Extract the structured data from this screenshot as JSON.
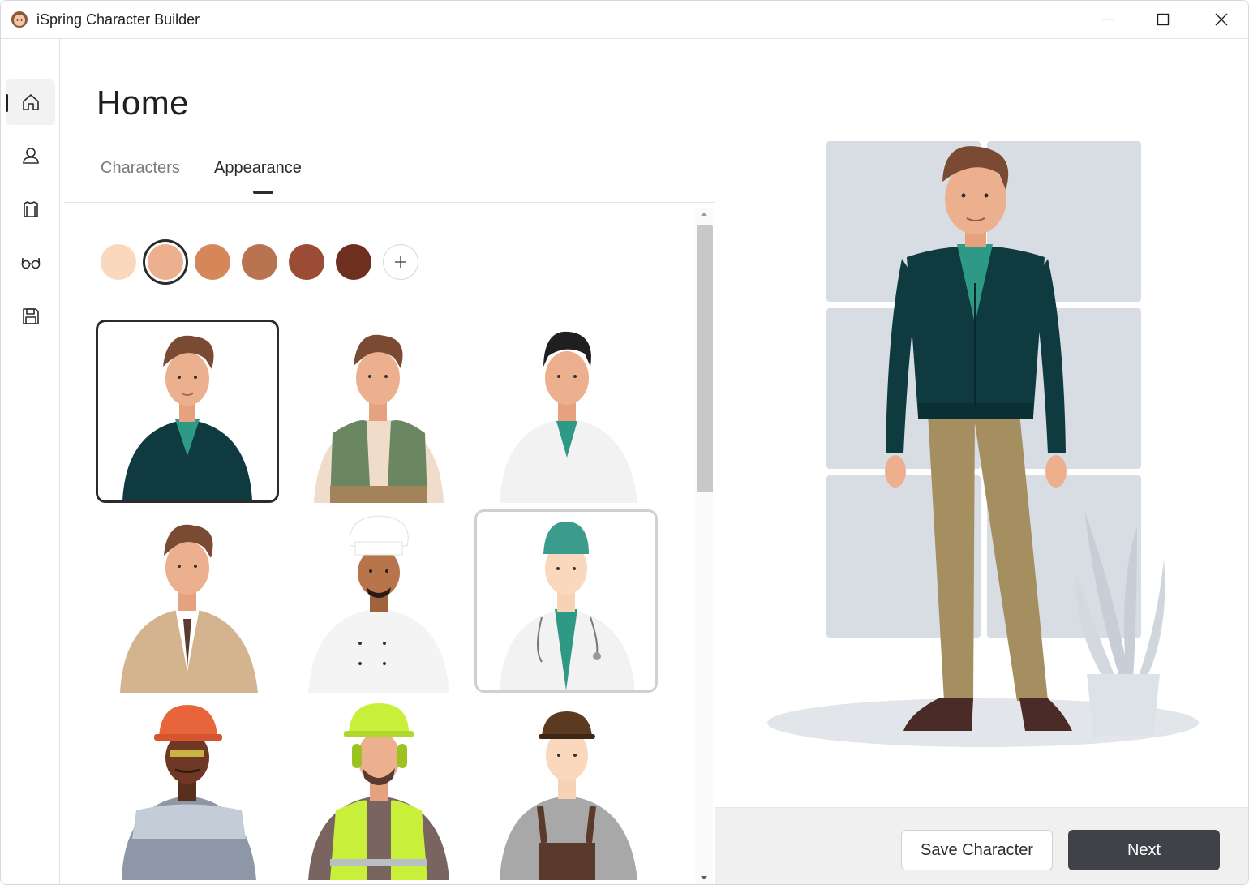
{
  "window": {
    "title": "iSpring Character Builder",
    "app_icon": "ispring-character-face-icon",
    "controls": {
      "minimize": "minimize-icon",
      "maximize": "maximize-icon",
      "close": "close-icon"
    }
  },
  "sidebar": {
    "items": [
      {
        "name": "home",
        "icon": "home-icon",
        "active": true
      },
      {
        "name": "character",
        "icon": "person-icon",
        "active": false
      },
      {
        "name": "clothing",
        "icon": "shirt-icon",
        "active": false
      },
      {
        "name": "accessories",
        "icon": "glasses-icon",
        "active": false
      },
      {
        "name": "save",
        "icon": "floppy-disk-icon",
        "active": false
      }
    ]
  },
  "main": {
    "title": "Home",
    "tabs": [
      {
        "label": "Characters",
        "active": false
      },
      {
        "label": "Appearance",
        "active": true
      }
    ],
    "skin_tones": {
      "colors": [
        "#f9d8bd",
        "#edb08e",
        "#d6875a",
        "#b87351",
        "#9c4b35",
        "#6e2f1e"
      ],
      "selected": "#edb08e",
      "add_icon": "plus-icon"
    },
    "characters": [
      {
        "id": "cardigan-man",
        "selected": true
      },
      {
        "id": "vest-man",
        "selected": false
      },
      {
        "id": "doctor-coat-man",
        "selected": false
      },
      {
        "id": "suit-man",
        "selected": false
      },
      {
        "id": "chef-man",
        "selected": false
      },
      {
        "id": "surgeon-man",
        "selected": false,
        "hovered": true
      },
      {
        "id": "hardhat-worker",
        "selected": false
      },
      {
        "id": "safety-vest-worker",
        "selected": false
      },
      {
        "id": "overalls-worker",
        "selected": false
      }
    ]
  },
  "footer": {
    "save_label": "Save Character",
    "next_label": "Next"
  },
  "colors": {
    "accent_dark": "#3f4347",
    "cardigan": "#0e3a40",
    "shirt": "#2e9a86",
    "pants": "#a58e60"
  }
}
